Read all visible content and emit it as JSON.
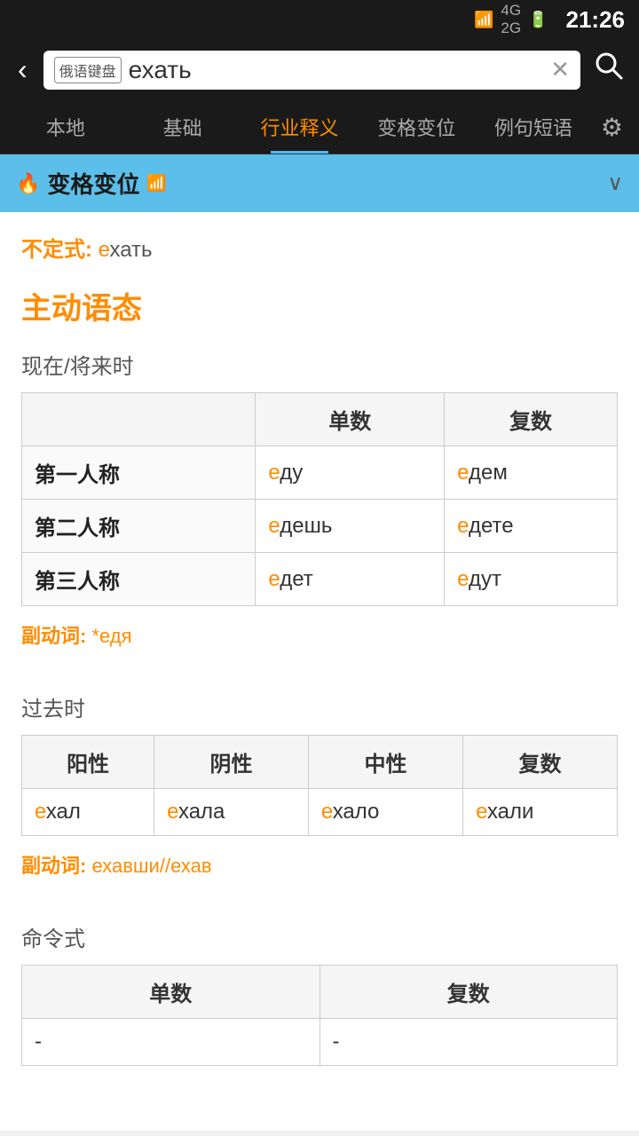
{
  "status": {
    "time": "21:26",
    "wifi": "WiFi",
    "network": "4G/2G",
    "battery": "Battery"
  },
  "header": {
    "search_text": "ехать",
    "keyboard_label": "俄语键盘",
    "clear_label": "×"
  },
  "nav": {
    "tabs": [
      {
        "id": "local",
        "label": "本地",
        "active": false
      },
      {
        "id": "basic",
        "label": "基础",
        "active": false
      },
      {
        "id": "industry",
        "label": "行业释义",
        "active": true
      },
      {
        "id": "conjugation",
        "label": "变格变位",
        "active": false
      },
      {
        "id": "examples",
        "label": "例句短语",
        "active": false
      }
    ]
  },
  "section": {
    "title": "变格变位",
    "chevron": "∨"
  },
  "content": {
    "infinitive_label": "不定式:",
    "infinitive_prefix": "е",
    "infinitive_suffix": "хать",
    "voice_title": "主动语态",
    "present_future": {
      "tense_label": "现在/将来时",
      "columns": [
        "",
        "单数",
        "复数"
      ],
      "rows": [
        {
          "person": "第一人称",
          "singular_prefix": "е",
          "singular_suffix": "ду",
          "plural_prefix": "е",
          "plural_suffix": "дем"
        },
        {
          "person": "第二人称",
          "singular_prefix": "е",
          "singular_suffix": "дешь",
          "plural_prefix": "е",
          "plural_suffix": "дете"
        },
        {
          "person": "第三人称",
          "singular_prefix": "е",
          "singular_suffix": "дет",
          "plural_prefix": "е",
          "plural_suffix": "дут"
        }
      ],
      "participle_label": "副动词:",
      "participle_value_prefix": "*е",
      "participle_value_suffix": "дя"
    },
    "past": {
      "tense_label": "过去时",
      "columns": [
        "阳性",
        "阴性",
        "中性",
        "复数"
      ],
      "rows": [
        {
          "masc_prefix": "е",
          "masc_suffix": "хал",
          "fem_prefix": "е",
          "fem_suffix": "хала",
          "neut_prefix": "е",
          "neut_suffix": "хало",
          "plur_prefix": "е",
          "plur_suffix": "хали"
        }
      ],
      "participle_label": "副动词:",
      "participle_value": "ехавши//ехав",
      "participle_prefix1": "е",
      "participle_mid1": "хавши//",
      "participle_prefix2": "е",
      "participle_mid2": "хав"
    },
    "imperative": {
      "tense_label": "命令式",
      "columns": [
        "单数",
        "复数"
      ],
      "rows": [
        {
          "singular": "-",
          "plural": "-"
        }
      ]
    }
  }
}
